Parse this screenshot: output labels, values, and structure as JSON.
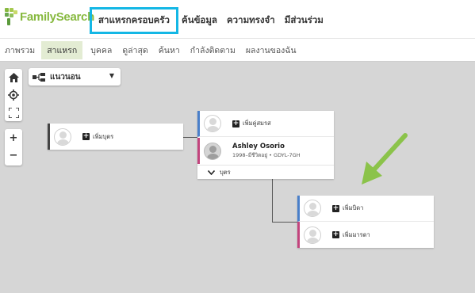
{
  "header": {
    "logo_text": "FamilySearch",
    "nav": [
      "สาแหรกครอบครัว",
      "ค้นข้อมูล",
      "ความทรงจำ",
      "มีส่วนร่วม"
    ]
  },
  "subnav": {
    "tabs": [
      "ภาพรวม",
      "สาแหรก",
      "บุคคล",
      "ดูล่าสุด",
      "ค้นหา",
      "กำลังติดตาม",
      "ผลงานของฉัน"
    ]
  },
  "controls": {
    "view_label": "แนวนอน",
    "caret": "▼",
    "zoom_in": "+",
    "zoom_out": "−"
  },
  "tree": {
    "child_card": {
      "add_label": "เพิ่มบุตร"
    },
    "person_card": {
      "add_spouse_label": "เพิ่มคู่สมรส",
      "person_name": "Ashley Osorio",
      "person_dates": "1998–มีชีวิตอยู่ • GDYL-7GH",
      "children_toggle": "บุตร"
    },
    "parents_card": {
      "add_father_label": "เพิ่มบิดา",
      "add_mother_label": "เพิ่มมารดา"
    }
  },
  "colors": {
    "active_highlight": "#14b7e5",
    "male": "#4a7fc9",
    "female": "#c2447d",
    "arrow": "#8bc34a",
    "logo": "#87b93f"
  }
}
